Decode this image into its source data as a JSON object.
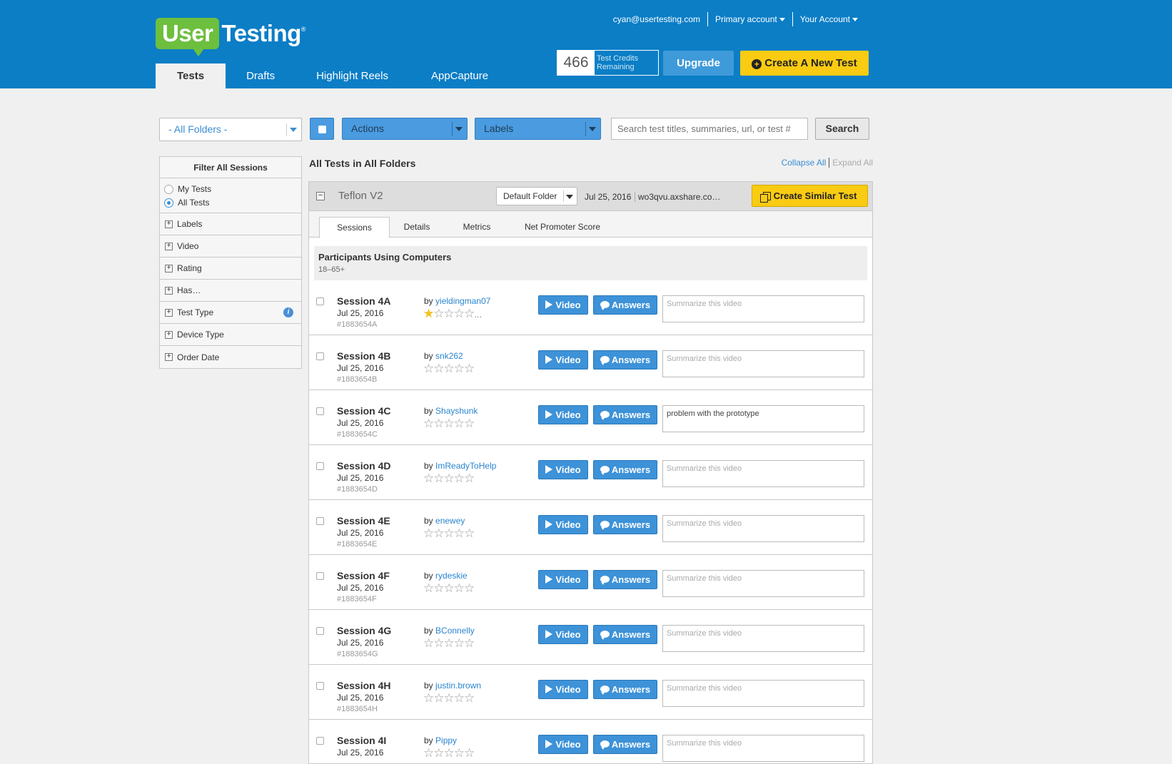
{
  "brand": {
    "logo_part1": "User",
    "logo_part2": "Testing",
    "logo_tm": "®"
  },
  "header": {
    "email": "cyan@usertesting.com",
    "primary_account": "Primary account",
    "your_account": "Your Account",
    "credits_count": "466",
    "credits_label_1": "Test Credits",
    "credits_label_2": "Remaining",
    "upgrade": "Upgrade",
    "create_new_test": "Create A New Test"
  },
  "main_tabs": [
    "Tests",
    "Drafts",
    "Highlight Reels",
    "AppCapture"
  ],
  "toolbar": {
    "folder_select": "- All Folders -",
    "actions": "Actions",
    "labels": "Labels",
    "search_placeholder": "Search test titles, summaries, url, or test #",
    "search_button": "Search"
  },
  "sidebar": {
    "title": "Filter All Sessions",
    "radios": [
      {
        "label": "My Tests",
        "checked": false
      },
      {
        "label": "All Tests",
        "checked": true
      }
    ],
    "items": [
      "Labels",
      "Video",
      "Rating",
      "Has…",
      "Test Type",
      "Device Type",
      "Order Date"
    ]
  },
  "main": {
    "title": "All Tests in All Folders",
    "collapse_all": "Collapse All",
    "expand_all": "Expand All"
  },
  "test": {
    "name": "Teflon V2",
    "folder": "Default Folder",
    "date": "Jul 25, 2016",
    "url": "wo3qvu.axshare.co…",
    "create_similar": "Create Similar Test",
    "tabs": [
      "Sessions",
      "Details",
      "Metrics",
      "Net Promoter Score"
    ],
    "participants_title": "Participants Using Computers",
    "participants_sub": "18–65+"
  },
  "session_labels": {
    "by": "by",
    "video": "Video",
    "answers": "Answers",
    "summary_placeholder": "Summarize this video"
  },
  "sessions": [
    {
      "name": "Session 4A",
      "date": "Jul 25, 2016",
      "id": "#1883654A",
      "user": "yieldingman07",
      "rating": 1,
      "summary": ""
    },
    {
      "name": "Session 4B",
      "date": "Jul 25, 2016",
      "id": "#1883654B",
      "user": "snk262",
      "rating": 0,
      "summary": ""
    },
    {
      "name": "Session 4C",
      "date": "Jul 25, 2016",
      "id": "#1883654C",
      "user": "Shayshunk",
      "rating": 0,
      "summary": "problem with the prototype"
    },
    {
      "name": "Session 4D",
      "date": "Jul 25, 2016",
      "id": "#1883654D",
      "user": "ImReadyToHelp",
      "rating": 0,
      "summary": ""
    },
    {
      "name": "Session 4E",
      "date": "Jul 25, 2016",
      "id": "#1883654E",
      "user": "enewey",
      "rating": 0,
      "summary": ""
    },
    {
      "name": "Session 4F",
      "date": "Jul 25, 2016",
      "id": "#1883654F",
      "user": "rydeskie",
      "rating": 0,
      "summary": ""
    },
    {
      "name": "Session 4G",
      "date": "Jul 25, 2016",
      "id": "#1883654G",
      "user": "BConnelly",
      "rating": 0,
      "summary": ""
    },
    {
      "name": "Session 4H",
      "date": "Jul 25, 2016",
      "id": "#1883654H",
      "user": "justin.brown",
      "rating": 0,
      "summary": ""
    },
    {
      "name": "Session 4I",
      "date": "Jul 25, 2016",
      "id": "",
      "user": "Pippy",
      "rating": 0,
      "summary": ""
    }
  ],
  "colors": {
    "header": "#0b7ec6",
    "logo_green": "#6dbf3e",
    "cta_yellow": "#f9cb12",
    "button_blue": "#3d92d8"
  }
}
